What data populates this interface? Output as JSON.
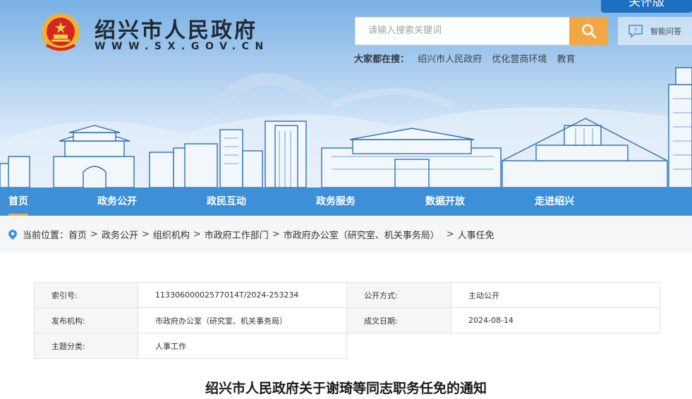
{
  "header": {
    "site_title": "绍兴市人民政府",
    "site_url": "WWW.SX.GOV.CN",
    "care_tab": "关怀版",
    "search_placeholder": "请输入搜索关键词",
    "qa_label": "智能问答",
    "hot_label": "大家都在搜：",
    "hot_words": [
      "绍兴市人民政府",
      "优化营商环境",
      "教育"
    ],
    "brand_color": "#3d8fd8",
    "accent_color": "#f2a744"
  },
  "nav": {
    "items": [
      "首页",
      "政务公开",
      "政民互动",
      "政务服务",
      "数据开放",
      "走进绍兴"
    ],
    "active": "首页"
  },
  "breadcrumb": {
    "label": "当前位置：",
    "items": [
      "首页",
      "政务公开",
      "组织机构",
      "市政府工作部门",
      "市政府办公室（研究室、机关事务局）",
      "人事任免"
    ]
  },
  "info": {
    "index_label": "索引号:",
    "index_value": "11330600002577014T/2024-253234",
    "open_label": "公开方式:",
    "open_value": "主动公开",
    "org_label": "发布机构:",
    "org_value": "市政府办公室（研究室、机关事务局）",
    "date_label": "成文日期:",
    "date_value": "2024-08-14",
    "topic_label": "主题分类:",
    "topic_value": "人事工作"
  },
  "document": {
    "title": "绍兴市人民政府关于谢琦等同志职务任免的通知"
  },
  "icons": [
    "national-emblem-icon",
    "search-icon",
    "chat-question-icon",
    "location-pin-icon"
  ]
}
